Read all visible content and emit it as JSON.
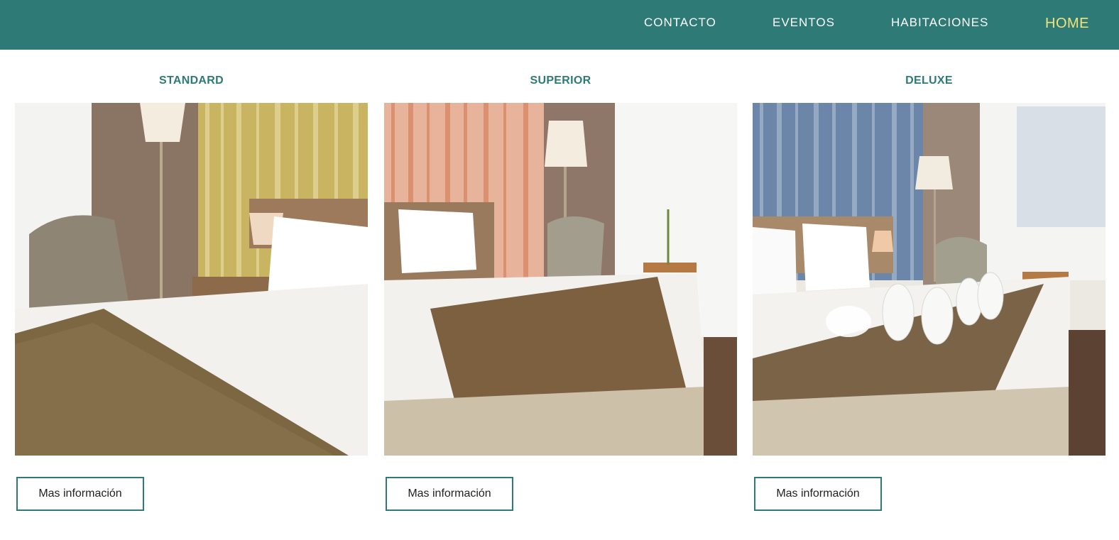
{
  "nav": {
    "items": [
      {
        "label": "CONTACTO"
      },
      {
        "label": "EVENTOS"
      },
      {
        "label": "HABITACIONES"
      },
      {
        "label": "HOME"
      }
    ],
    "colors": {
      "bar": "#2e7a76",
      "link": "#ffffff",
      "active": "#f4e27a"
    }
  },
  "rooms": [
    {
      "title": "STANDARD",
      "button": "Mas información",
      "image": "hotel-room-photo"
    },
    {
      "title": "SUPERIOR",
      "button": "Mas información",
      "image": "hotel-room-photo"
    },
    {
      "title": "DELUXE",
      "button": "Mas información",
      "image": "hotel-room-photo"
    }
  ]
}
